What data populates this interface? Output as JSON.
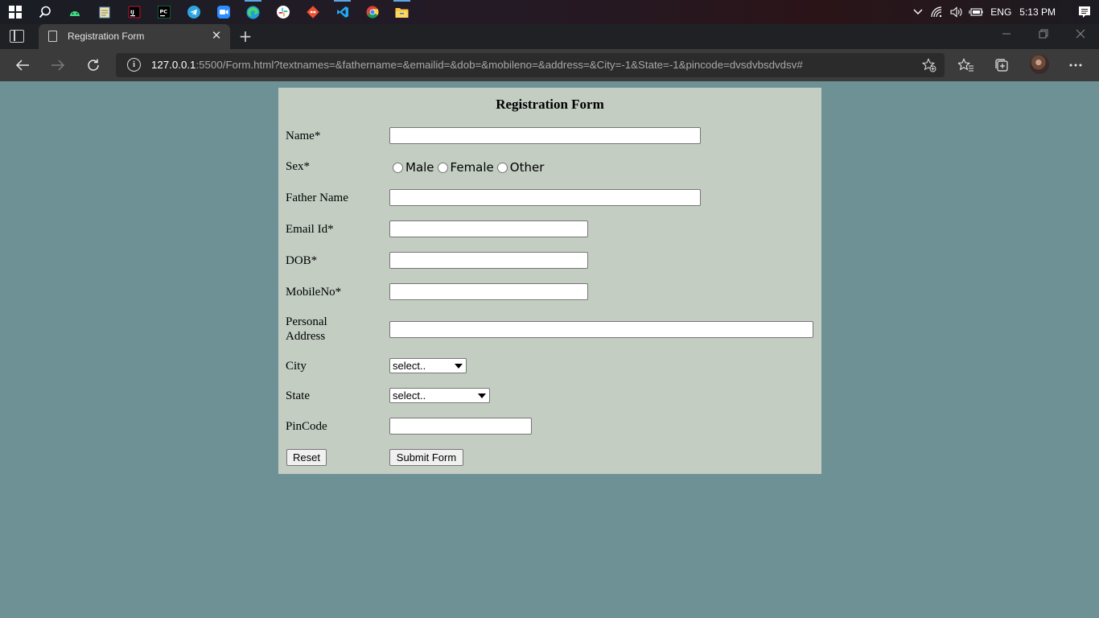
{
  "taskbar": {
    "apps": [
      {
        "icon": "windows-start-icon",
        "active": false
      },
      {
        "icon": "search-icon",
        "active": false
      },
      {
        "icon": "android-studio-icon",
        "active": false
      },
      {
        "icon": "notepad-icon",
        "active": false
      },
      {
        "icon": "intellij-icon",
        "active": false
      },
      {
        "icon": "pycharm-icon",
        "active": false
      },
      {
        "icon": "telegram-icon",
        "active": false
      },
      {
        "icon": "zoom-icon",
        "active": false
      },
      {
        "icon": "edge-icon",
        "active": true
      },
      {
        "icon": "slack-icon",
        "active": false
      },
      {
        "icon": "git-icon",
        "active": false
      },
      {
        "icon": "vscode-icon",
        "active": true
      },
      {
        "icon": "chrome-icon",
        "active": false
      },
      {
        "icon": "file-explorer-icon",
        "active": true
      }
    ],
    "language": "ENG",
    "time": "5:13 PM"
  },
  "browser": {
    "tab_title": "Registration Form",
    "url_host": "127.0.0.1",
    "url_rest": ":5500/Form.html?textnames=&fathername=&emailid=&dob=&mobileno=&address=&City=-1&State=-1&pincode=dvsdvbsdvdsv#"
  },
  "form": {
    "title": "Registration Form",
    "labels": {
      "name": "Name*",
      "sex": "Sex*",
      "father_name": "Father Name",
      "email": "Email Id*",
      "dob": "DOB*",
      "mobile": "MobileNo*",
      "address_line1": "Personal",
      "address_line2": "Address",
      "city": "City",
      "state": "State",
      "pincode": "PinCode"
    },
    "sex_options": [
      "Male",
      "Female",
      "Other"
    ],
    "city_selected": "select..",
    "state_selected": "select..",
    "buttons": {
      "reset": "Reset",
      "submit": "Submit Form"
    }
  },
  "colors": {
    "page_background": "#6e9196",
    "form_background": "#c3cdc2",
    "browser_chrome": "#3b3b3b"
  }
}
